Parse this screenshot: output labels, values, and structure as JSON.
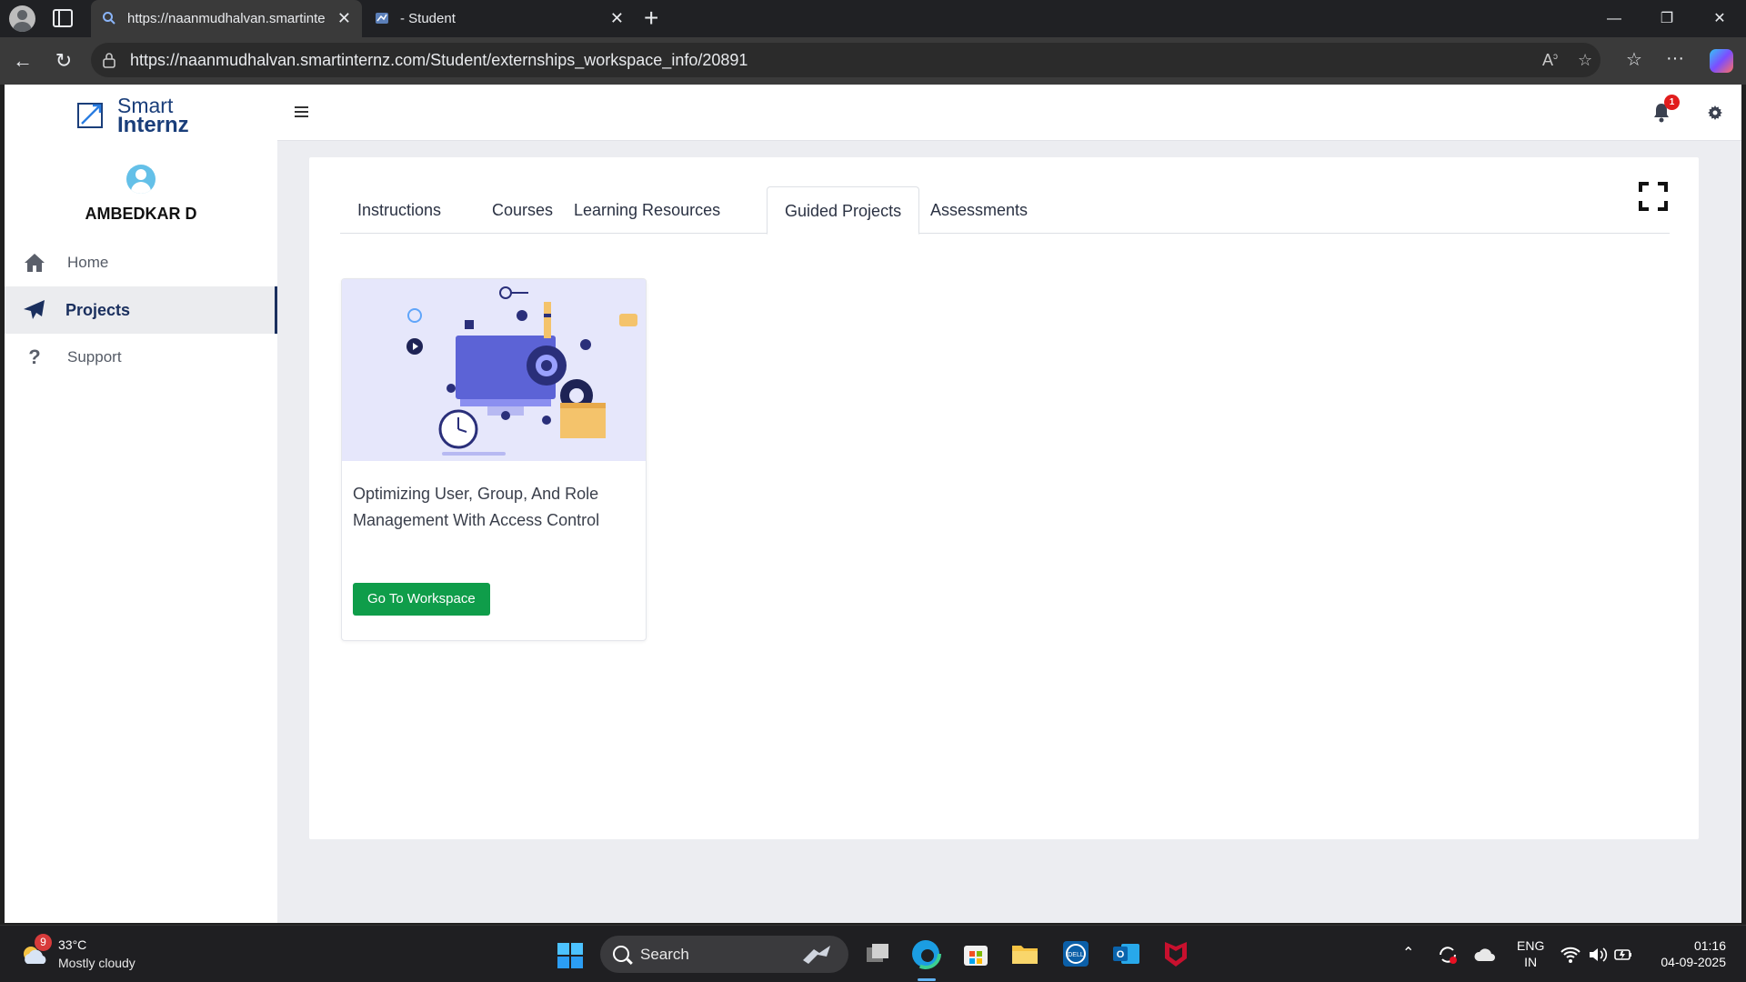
{
  "browser": {
    "tabs": [
      {
        "title": "https://naanmudhalvan.smartinternz.com/Student/externships_workspace_info/20891",
        "active": true
      },
      {
        "title": "- Student",
        "active": false
      }
    ],
    "url": "https://naanmudhalvan.smartinternz.com/Student/externships_workspace_info/20891"
  },
  "sidebar": {
    "logo_line1": "Smart",
    "logo_line2": "Internz",
    "user_name": "AMBEDKAR D",
    "items": [
      {
        "label": "Home",
        "icon": "home-icon",
        "active": false
      },
      {
        "label": "Projects",
        "icon": "paper-plane-icon",
        "active": true
      },
      {
        "label": "Support",
        "icon": "question-icon",
        "active": false
      }
    ]
  },
  "topbar": {
    "notification_count": "1"
  },
  "main": {
    "tabs": [
      {
        "label": "Instructions"
      },
      {
        "label": "Courses"
      },
      {
        "label": "Learning Resources"
      },
      {
        "label": "Guided Projects",
        "active": true
      },
      {
        "label": "Assessments"
      }
    ],
    "projects": [
      {
        "title": "Optimizing User, Group, And Role Management With Access Control",
        "button_label": "Go To Workspace"
      }
    ]
  },
  "taskbar": {
    "weather_badge": "9",
    "temperature": "33°C",
    "condition": "Mostly cloudy",
    "search_placeholder": "Search",
    "lang_line1": "ENG",
    "lang_line2": "IN",
    "time": "01:16",
    "date": "04-09-2025"
  },
  "colors": {
    "accent_navy": "#1a2f5e",
    "button_green": "#0f9d4a",
    "badge_red": "#e11d1d",
    "page_bg": "#ecedf1"
  }
}
